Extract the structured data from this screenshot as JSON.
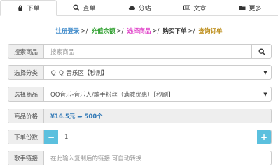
{
  "tabs": [
    {
      "label": "下单",
      "icon": "shopping-bag-icon",
      "active": true
    },
    {
      "label": "查单",
      "icon": "search-icon",
      "active": false
    },
    {
      "label": "分站",
      "icon": "cloud-icon",
      "active": false
    },
    {
      "label": "文章",
      "icon": "keyboard-icon",
      "active": false
    },
    {
      "label": "更多",
      "icon": "folder-icon",
      "active": false
    }
  ],
  "steps": [
    {
      "label": "注册登录",
      "color": "#3a87c9"
    },
    {
      "label": "充值余额",
      "color": "#2ea02e"
    },
    {
      "label": "选择商品",
      "color": "#e044c9"
    },
    {
      "label": "购买下单",
      "color": "#333333"
    },
    {
      "label": "查询订单",
      "color": "#b8860b"
    }
  ],
  "step_separator": ">/",
  "form": {
    "search": {
      "label": "搜索商品",
      "placeholder": "搜索商品"
    },
    "category": {
      "label": "选择分类",
      "value": "Ｑ Ｑ 音乐区【秒刷】"
    },
    "product": {
      "label": "选择商品",
      "value": "QQ音乐-音乐人/歌手粉丝（满减优惠）【秒刷】"
    },
    "price": {
      "label": "商品价格",
      "value": "¥16.5元 ➡ 500个"
    },
    "quantity": {
      "label": "下单份数",
      "value": "1",
      "minus": "−",
      "plus": "+"
    },
    "link": {
      "label": "歌手链接",
      "placeholder": "在此输入复制后的链接 可自动转换"
    }
  },
  "colors": {
    "accent": "#5bc0de",
    "price": "#337ab7"
  }
}
